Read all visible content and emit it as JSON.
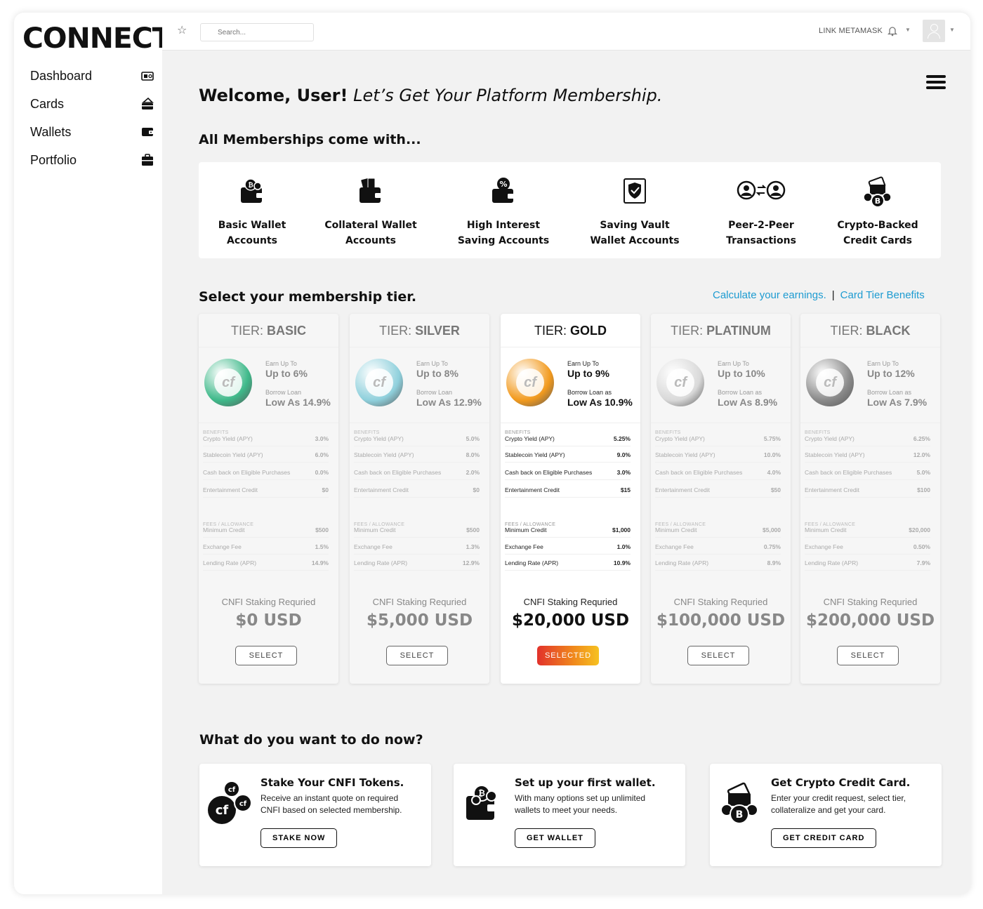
{
  "app": {
    "logo": "CONNECT"
  },
  "sidebar": {
    "items": [
      {
        "label": "Dashboard",
        "icon": "dashboard-icon"
      },
      {
        "label": "Cards",
        "icon": "cards-icon"
      },
      {
        "label": "Wallets",
        "icon": "wallet-icon"
      },
      {
        "label": "Portfolio",
        "icon": "briefcase-icon"
      }
    ]
  },
  "topbar": {
    "search_placeholder": "Search...",
    "link_metamask": "LINK METAMASK"
  },
  "welcome": {
    "bold": "Welcome, User!",
    "italic": "Let’s Get Your Platform Membership."
  },
  "features": {
    "heading": "All Memberships come with...",
    "items": [
      {
        "line1": "Basic Wallet",
        "line2": "Accounts",
        "icon": "wallet-crypto-icon"
      },
      {
        "line1": "Collateral Wallet",
        "line2": "Accounts",
        "icon": "wallet-cards-icon"
      },
      {
        "line1": "High Interest",
        "line2": "Saving Accounts",
        "icon": "wallet-percent-icon"
      },
      {
        "line1": "Saving Vault",
        "line2": "Wallet Accounts",
        "icon": "vault-shield-icon"
      },
      {
        "line1": "Peer-2-Peer",
        "line2": "Transactions",
        "icon": "peer-transfer-icon"
      },
      {
        "line1": "Crypto-Backed",
        "line2": "Credit Cards",
        "icon": "crypto-card-icon"
      }
    ]
  },
  "tiers_section": {
    "heading": "Select your membership tier.",
    "link_calc": "Calculate your earnings.",
    "link_sep": "|",
    "link_benefits": "Card Tier Benefits"
  },
  "tier_labels": {
    "prefix": "TIER: ",
    "benefits": "BENEFITS",
    "fees": "FEES / ALLOWANCE",
    "staking": "CNFI Staking Requried",
    "earn": "Earn Up To",
    "borrow": "Borrow Loan",
    "borrow_as": "Borrow Loan as"
  },
  "tiers": [
    {
      "name": "BASIC",
      "earn": "Up to 6%",
      "borrow_label": "Borrow Loan",
      "borrow": "Low As 14.9%",
      "crypto_yield": "3.0%",
      "stable_yield": "6.0%",
      "cash_back": "0.0%",
      "ent_credit": "$0",
      "min_credit": "$500",
      "exch_fee": "1.5%",
      "lend_rate": "14.9%",
      "stake": "$0 USD",
      "button": "SELECT",
      "selected": false,
      "coin": "#3fb98a"
    },
    {
      "name": "SILVER",
      "earn": "Up to 8%",
      "borrow_label": "Borrow Loan",
      "borrow": "Low As 12.9%",
      "crypto_yield": "5.0%",
      "stable_yield": "8.0%",
      "cash_back": "2.0%",
      "ent_credit": "$0",
      "min_credit": "$500",
      "exch_fee": "1.3%",
      "lend_rate": "12.9%",
      "stake": "$5,000 USD",
      "button": "SELECT",
      "selected": false,
      "coin": "#8fd0dc"
    },
    {
      "name": "GOLD",
      "earn": "Up to 9%",
      "borrow_label": "Borrow Loan as",
      "borrow": "Low As 10.9%",
      "crypto_yield": "5.25%",
      "stable_yield": "9.0%",
      "cash_back": "3.0%",
      "ent_credit": "$15",
      "min_credit": "$1,000",
      "exch_fee": "1.0%",
      "lend_rate": "10.9%",
      "stake": "$20,000 USD",
      "button": "SELECTED",
      "selected": true,
      "coin": "#f29a1e"
    },
    {
      "name": "PLATINUM",
      "earn": "Up to 10%",
      "borrow_label": "Borrow Loan as",
      "borrow": "Low As 8.9%",
      "crypto_yield": "5.75%",
      "stable_yield": "10.0%",
      "cash_back": "4.0%",
      "ent_credit": "$50",
      "min_credit": "$5,000",
      "exch_fee": "0.75%",
      "lend_rate": "8.9%",
      "stake": "$100,000 USD",
      "button": "SELECT",
      "selected": false,
      "coin": "#d9d9d9"
    },
    {
      "name": "BLACK",
      "earn": "Up to 12%",
      "borrow_label": "Borrow Loan as",
      "borrow": "Low As 7.9%",
      "crypto_yield": "6.25%",
      "stable_yield": "12.0%",
      "cash_back": "5.0%",
      "ent_credit": "$100",
      "min_credit": "$20,000",
      "exch_fee": "0.50%",
      "lend_rate": "7.9%",
      "stake": "$200,000 USD",
      "button": "SELECT",
      "selected": false,
      "coin": "#8a8a8a"
    }
  ],
  "row_labels": {
    "crypto_yield": "Crypto Yield (APY)",
    "stable_yield": "Stablecoin Yield (APY)",
    "cash_back": "Cash back on Eligible Purchases",
    "ent_credit": "Entertainment Credit",
    "min_credit": "Minimum Credit",
    "exch_fee": "Exchange Fee",
    "lend_rate": "Lending Rate (APR)"
  },
  "actions": {
    "heading": "What do you want to do now?",
    "items": [
      {
        "title": "Stake Your CNFI Tokens.",
        "text": "Receive an instant quote on required CNFI based on selected membership.",
        "button": "STAKE NOW",
        "icon": "cnfi-coins-icon"
      },
      {
        "title": "Set up your first wallet.",
        "text": "With many options set up unlimited wallets to meet your needs.",
        "button": "GET WALLET",
        "icon": "wallet-crypto-icon"
      },
      {
        "title": "Get Crypto Credit Card.",
        "text": "Enter your credit request, select tier, collateralize and get your card.",
        "button": "GET CREDIT CARD",
        "icon": "crypto-card-icon"
      }
    ]
  }
}
